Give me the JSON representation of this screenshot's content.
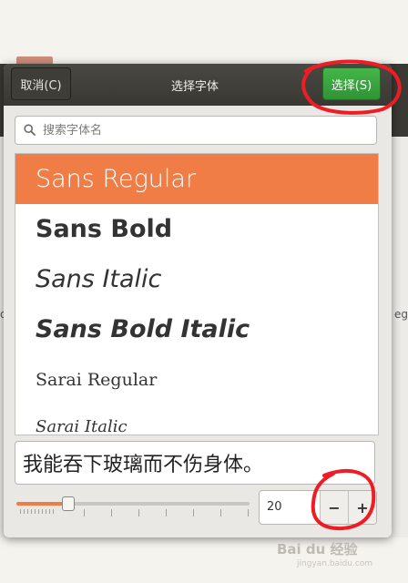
{
  "background": {
    "left_edge_text": "d",
    "right_edge_text": "eg"
  },
  "dialog": {
    "title": "选择字体",
    "cancel_label": "取消(C)",
    "select_label": "选择(S)",
    "accent_color": "#ef7d45",
    "select_color": "#3aa83f"
  },
  "search": {
    "placeholder": "搜索字体名",
    "value": ""
  },
  "fonts": [
    {
      "name": "Sans Regular",
      "selected": true
    },
    {
      "name": "Sans Bold",
      "selected": false
    },
    {
      "name": "Sans Italic",
      "selected": false
    },
    {
      "name": "Sans Bold Italic",
      "selected": false
    },
    {
      "name": "Sarai  Regular",
      "selected": false
    },
    {
      "name": "Sarai  Italic",
      "selected": false
    }
  ],
  "preview_text": "我能吞下玻璃而不伤身体。",
  "size": {
    "value": "20",
    "slider_fraction": 0.22,
    "minus_label": "−",
    "plus_label": "+"
  },
  "watermark": {
    "brand": "Bai du 经验",
    "url": "jingyan.baidu.com"
  }
}
